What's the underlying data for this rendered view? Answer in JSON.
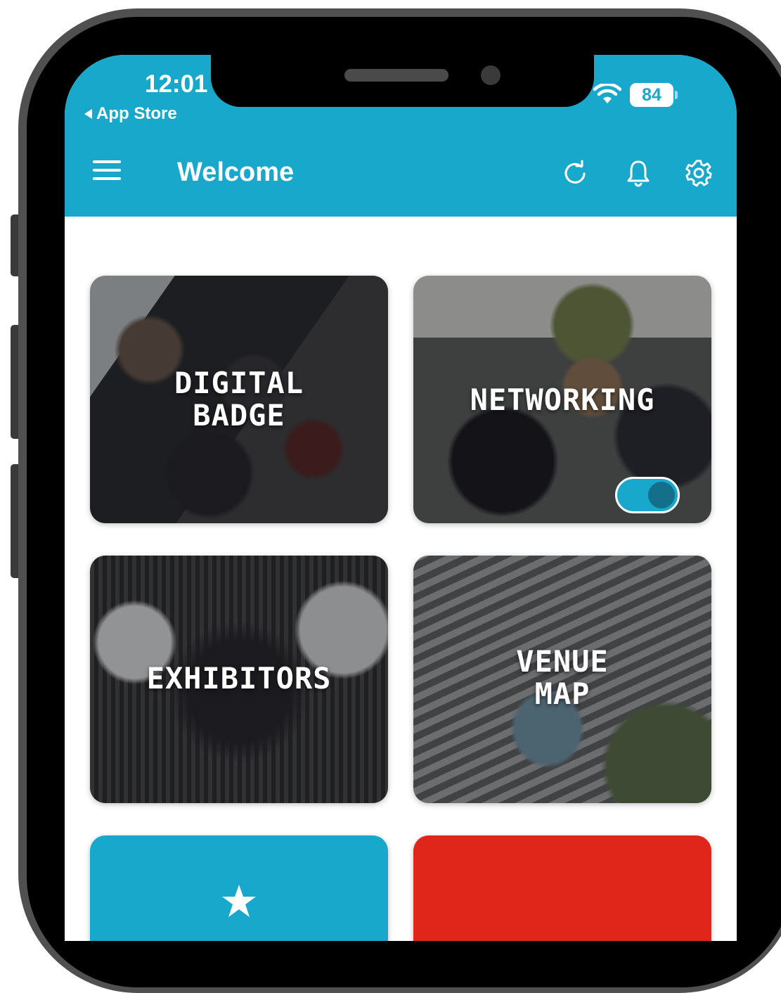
{
  "status_bar": {
    "time": "12:01",
    "back_label": "App Store",
    "battery": "84"
  },
  "nav": {
    "title": "Welcome",
    "icons": [
      "menu-icon",
      "refresh-icon",
      "bell-icon",
      "gear-icon"
    ]
  },
  "tiles": [
    {
      "label": "DIGITAL\nBADGE"
    },
    {
      "label": "NETWORKING",
      "toggle_on": true
    },
    {
      "label": "EXHIBITORS"
    },
    {
      "label": "VENUE\nMAP"
    }
  ],
  "bottom_tiles": [
    {
      "color": "#17a8cc",
      "icon": "star-icon"
    },
    {
      "color": "#e0251a"
    }
  ],
  "colors": {
    "accent": "#17a8cc",
    "phone_frame": "#505050",
    "red": "#e0251a"
  }
}
